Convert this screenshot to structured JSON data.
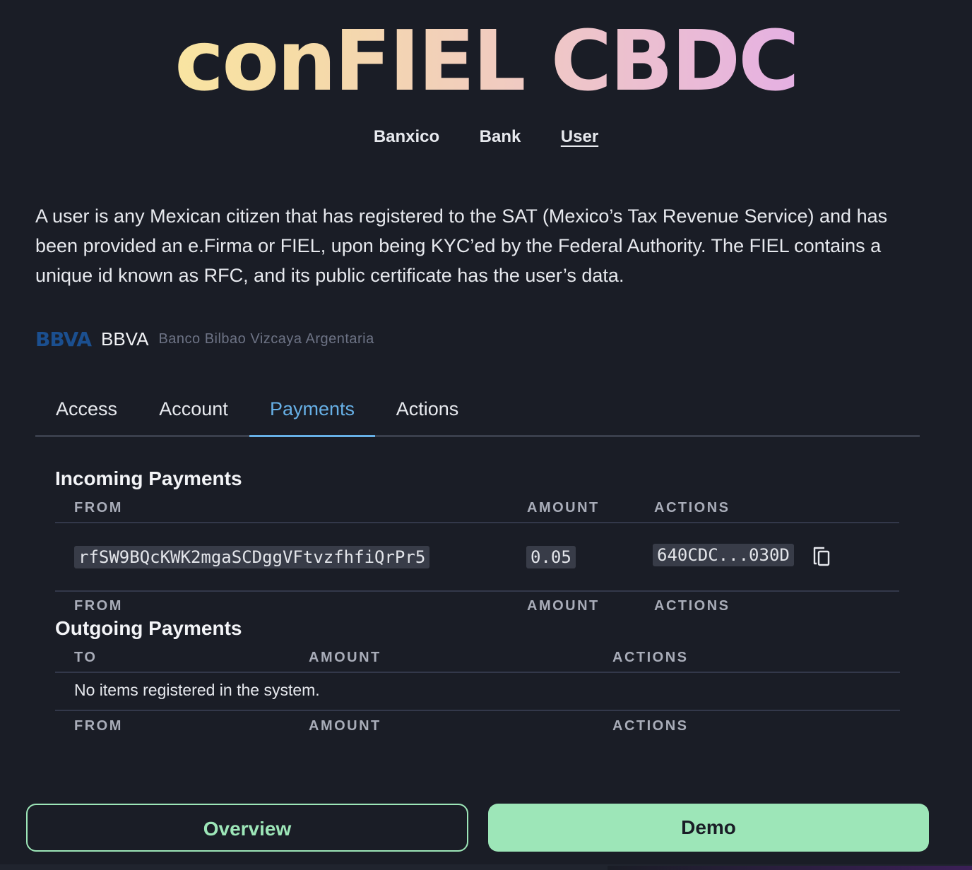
{
  "app": {
    "title": "conFIEL CBDC"
  },
  "topnav": {
    "items": [
      "Banxico",
      "Bank",
      "User"
    ],
    "active": "User"
  },
  "description": "A user is any Mexican citizen that has registered to the SAT (Mexico’s Tax Revenue Service) and has been provided an e.Firma or FIEL, upon being KYC’ed by the Federal Authority. The FIEL contains a unique id known as RFC, and its public certificate has the user’s data.",
  "bank": {
    "logo": "BBVA",
    "name": "BBVA",
    "full_name": "Banco Bilbao Vizcaya Argentaria",
    "logo_color": "#1b4f8f"
  },
  "tabs": {
    "items": [
      "Access",
      "Account",
      "Payments",
      "Actions"
    ],
    "active": "Payments"
  },
  "incoming": {
    "title": "Incoming Payments",
    "headers": [
      "FROM",
      "AMOUNT",
      "ACTIONS"
    ],
    "rows": [
      {
        "from": "rfSW9BQcKWK2mgaSCDggVFtvzfhfiQrPr5",
        "amount": "0.05",
        "tx": "640CDC...030D",
        "action_icon": "copy-icon"
      }
    ],
    "footer_headers": [
      "FROM",
      "AMOUNT",
      "ACTIONS"
    ]
  },
  "outgoing": {
    "title": "Outgoing Payments",
    "headers": [
      "TO",
      "AMOUNT",
      "ACTIONS"
    ],
    "empty_text": "No items registered in the system.",
    "footer_headers": [
      "FROM",
      "AMOUNT",
      "ACTIONS"
    ]
  },
  "buttons": {
    "overview": "Overview",
    "demo": "Demo"
  },
  "colors": {
    "background": "#1a1d26",
    "accent_tab": "#67b0e6",
    "button_green": "#9de6b8"
  }
}
